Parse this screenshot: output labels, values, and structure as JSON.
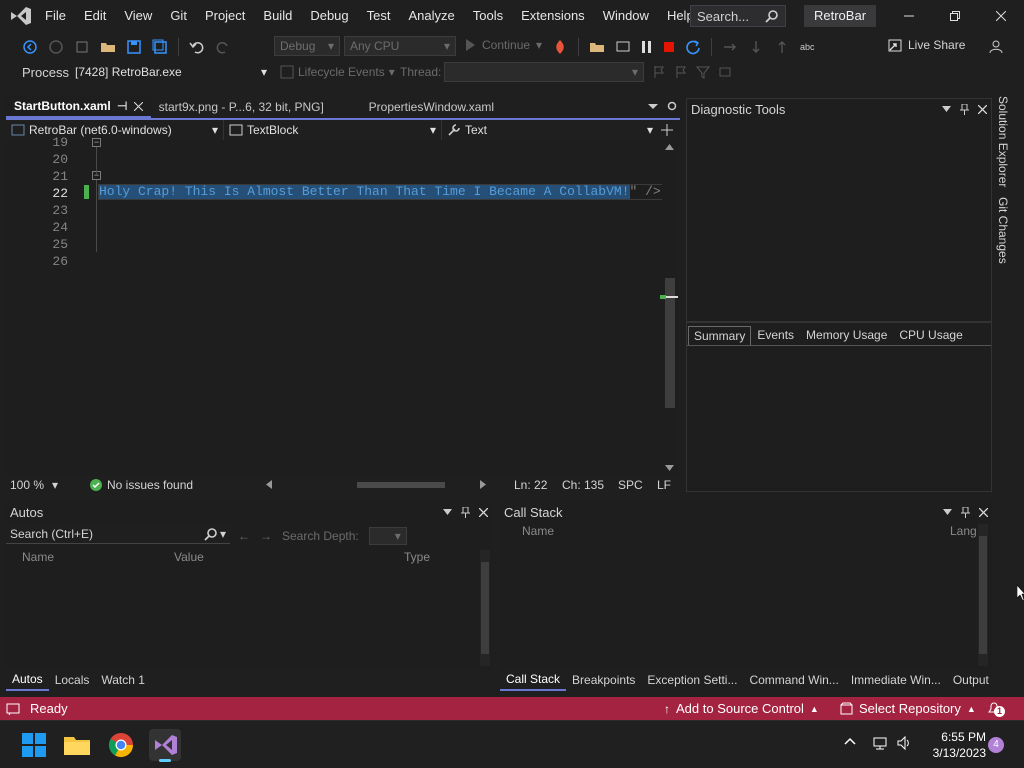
{
  "menubar": {
    "items": [
      "File",
      "Edit",
      "View",
      "Git",
      "Project",
      "Build",
      "Debug",
      "Test",
      "Analyze",
      "Tools",
      "Extensions",
      "Window",
      "Help"
    ]
  },
  "search": {
    "label": "Search..."
  },
  "solution_name": "RetroBar",
  "toolbar": {
    "config": "Debug",
    "platform": "Any CPU",
    "continue_label": "Continue",
    "live_share": "Live Share"
  },
  "debug_location": {
    "process_label": "Process:",
    "process_value": "[7428] RetroBar.exe",
    "lifecycle_label": "Lifecycle Events",
    "thread_label": "Thread:"
  },
  "doc_tabs": [
    {
      "label": "StartButton.xaml",
      "active": true
    },
    {
      "label": "start9x.png - P...6, 32 bit, PNG]",
      "active": false
    },
    {
      "label": "PropertiesWindow.xaml",
      "active": false
    }
  ],
  "navbar": {
    "project": "RetroBar (net6.0-windows)",
    "element": "TextBlock",
    "member": "Text"
  },
  "editor": {
    "line_numbers": [
      "19",
      "20",
      "21",
      "22",
      "23",
      "24",
      "25",
      "26"
    ],
    "current_line": "22",
    "code_selected": "Holy Crap! This Is Almost Better Than That Time I Became A CollabVM!",
    "code_rest": "\" />"
  },
  "editor_status": {
    "zoom": "100 %",
    "issues": "No issues found",
    "line": "Ln: 22",
    "col": "Ch: 135",
    "whitespace": "SPC",
    "eol": "LF"
  },
  "diagnostic_tools": {
    "title": "Diagnostic Tools",
    "tabs": [
      "Summary",
      "Events",
      "Memory Usage",
      "CPU Usage"
    ]
  },
  "side_tabs": [
    "Solution Explorer",
    "Git Changes"
  ],
  "autos": {
    "title": "Autos",
    "search_placeholder": "Search (Ctrl+E)",
    "depth_label": "Search Depth:",
    "columns": [
      "Name",
      "Value",
      "Type"
    ],
    "tabs": [
      "Autos",
      "Locals",
      "Watch 1"
    ]
  },
  "callstack": {
    "title": "Call Stack",
    "columns": [
      "Name",
      "Lang"
    ],
    "tabs": [
      "Call Stack",
      "Breakpoints",
      "Exception Setti...",
      "Command Win...",
      "Immediate Win...",
      "Output"
    ]
  },
  "statusbar": {
    "ready": "Ready",
    "source_control": "Add to Source Control",
    "repository": "Select Repository",
    "notifications": "1"
  },
  "taskbar": {
    "time": "6:55 PM",
    "date": "3/13/2023",
    "badge": "4"
  },
  "colors": {
    "accent": "#6b78d3",
    "statusbar": "#a42341",
    "selection": "#264f78"
  }
}
